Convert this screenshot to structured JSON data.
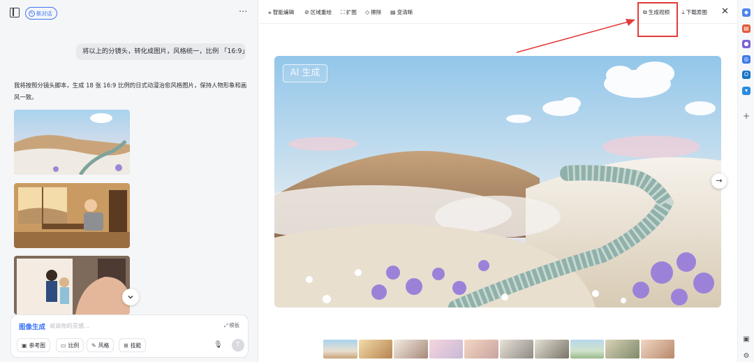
{
  "left_panel": {
    "new_chat_label": "新对话",
    "more_label": "···",
    "user_message": "将以上的分镜头，转化成图片，风格统一，比例 「16:9」",
    "ai_response": "我将按照分镜头脚本，生成 18 张 16:9 比例的日式动漫治愈风格图片，保持人物形象和画风一致。",
    "composer": {
      "mode_label": "图像生成",
      "placeholder": "说说你的灵感...",
      "template_label": "模板",
      "chips": [
        {
          "label": "参考图",
          "icon": "image-icon"
        },
        {
          "label": "比例",
          "icon": "ratio-icon"
        },
        {
          "label": "风格",
          "icon": "brush-icon"
        },
        {
          "label": "技能",
          "icon": "skills-icon"
        }
      ]
    }
  },
  "toolbar": {
    "tools": [
      {
        "label": "智能编辑",
        "icon": "magic-wand-icon"
      },
      {
        "label": "区域重绘",
        "icon": "repaint-icon"
      },
      {
        "label": "扩图",
        "icon": "expand-icon"
      },
      {
        "label": "擦除",
        "icon": "eraser-icon"
      },
      {
        "label": "变清晰",
        "icon": "hd-icon"
      }
    ],
    "generate_video_label": "生成视频",
    "download_label": "下载原图"
  },
  "preview": {
    "ai_badge": "AI 生成",
    "thumbnail_count": 10
  },
  "colors": {
    "accent": "#3b74f6",
    "annotation": "#e23b3b",
    "panel_bg": "#f5f6f8"
  }
}
